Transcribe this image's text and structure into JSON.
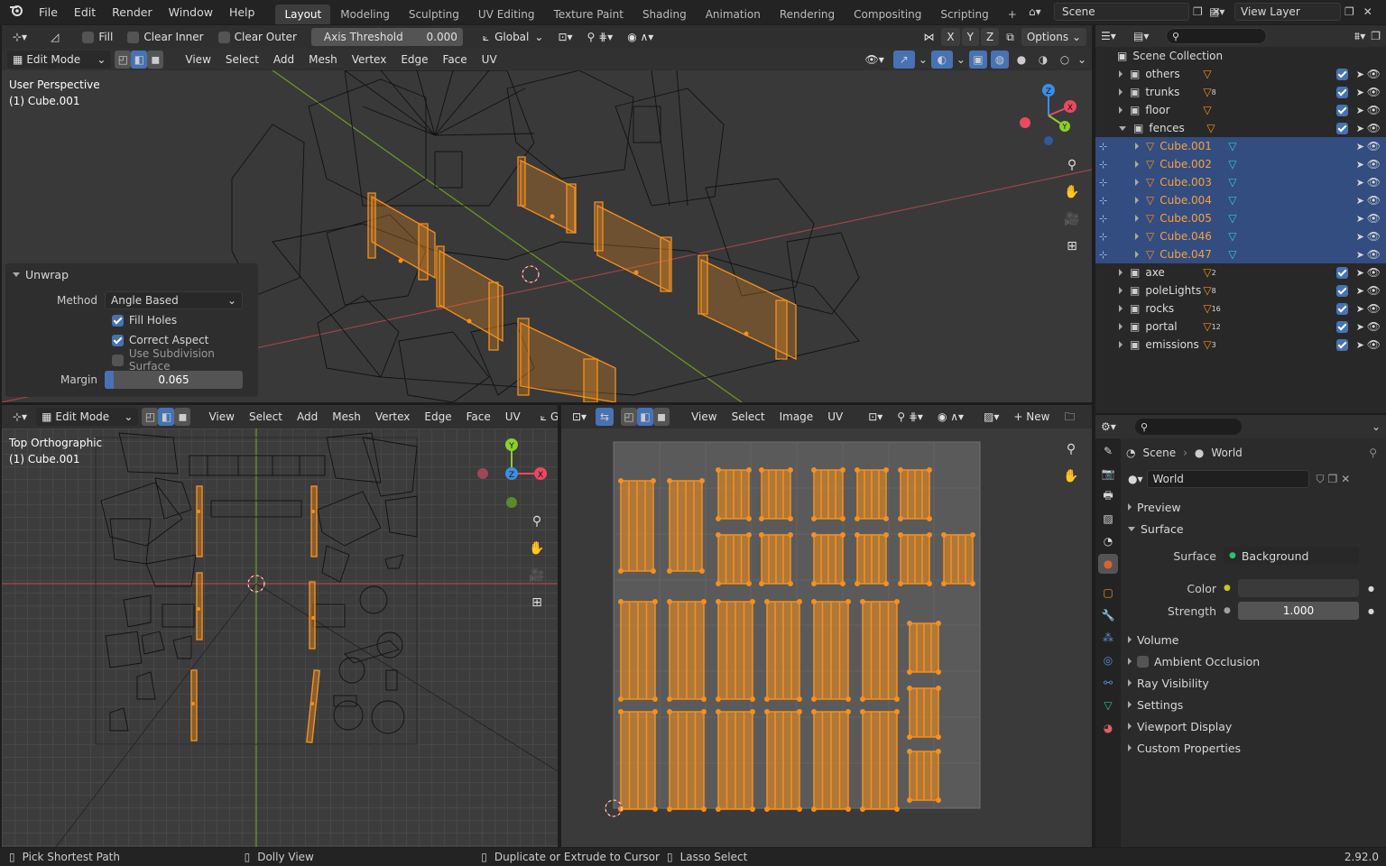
{
  "topbar": {
    "menus": [
      "File",
      "Edit",
      "Render",
      "Window",
      "Help"
    ],
    "tabs": [
      "Layout",
      "Modeling",
      "Sculpting",
      "UV Editing",
      "Texture Paint",
      "Shading",
      "Animation",
      "Rendering",
      "Compositing",
      "Scripting"
    ],
    "active_tab": "Layout",
    "scene": "Scene",
    "view_layer": "View Layer"
  },
  "viewport_top": {
    "tool_header": {
      "fill": "Fill",
      "clear_inner": "Clear Inner",
      "clear_outer": "Clear Outer",
      "axis_threshold_label": "Axis Threshold",
      "axis_threshold_value": "0.000",
      "orientation": "Global",
      "axes": [
        "X",
        "Y",
        "Z"
      ],
      "options": "Options"
    },
    "header": {
      "mode": "Edit Mode",
      "menus": [
        "View",
        "Select",
        "Add",
        "Mesh",
        "Vertex",
        "Edge",
        "Face",
        "UV"
      ]
    },
    "overlay_title": "User Perspective",
    "overlay_object": "(1) Cube.001",
    "gizmo_axes": [
      "Z",
      "X",
      "Y"
    ]
  },
  "unwrap_panel": {
    "title": "Unwrap",
    "method_label": "Method",
    "method_value": "Angle Based",
    "fill_holes": "Fill Holes",
    "correct_aspect": "Correct Aspect",
    "use_subdivision": "Use Subdivision Surface",
    "margin_label": "Margin",
    "margin_value": "0.065",
    "margin_fraction": 0.065
  },
  "viewport_bottom": {
    "header": {
      "mode": "Edit Mode",
      "menus": [
        "View",
        "Select",
        "Add",
        "Mesh",
        "Vertex",
        "Edge",
        "Face",
        "UV"
      ],
      "orientation": "Glob"
    },
    "overlay_title": "Top Orthographic",
    "overlay_object": "(1) Cube.001",
    "gizmo_axes": [
      "Y",
      "Z",
      "X"
    ]
  },
  "uv_editor": {
    "menus": [
      "View",
      "Select",
      "Image",
      "UV"
    ],
    "new_label": "New"
  },
  "outliner": {
    "root": "Scene Collection",
    "items": [
      {
        "name": "others",
        "count": "",
        "selected": false,
        "expanded": false,
        "child": false
      },
      {
        "name": "trunks",
        "count": "8",
        "selected": false,
        "expanded": false,
        "child": false
      },
      {
        "name": "floor",
        "count": "",
        "selected": false,
        "expanded": false,
        "child": false
      },
      {
        "name": "fences",
        "count": "",
        "selected": false,
        "expanded": true,
        "child": false
      },
      {
        "name": "Cube.001",
        "count": "",
        "selected": true,
        "expanded": false,
        "child": true
      },
      {
        "name": "Cube.002",
        "count": "",
        "selected": true,
        "expanded": false,
        "child": true
      },
      {
        "name": "Cube.003",
        "count": "",
        "selected": true,
        "expanded": false,
        "child": true
      },
      {
        "name": "Cube.004",
        "count": "",
        "selected": true,
        "expanded": false,
        "child": true
      },
      {
        "name": "Cube.005",
        "count": "",
        "selected": true,
        "expanded": false,
        "child": true
      },
      {
        "name": "Cube.046",
        "count": "",
        "selected": true,
        "expanded": false,
        "child": true
      },
      {
        "name": "Cube.047",
        "count": "",
        "selected": true,
        "expanded": false,
        "child": true
      },
      {
        "name": "axe",
        "count": "2",
        "selected": false,
        "expanded": false,
        "child": false
      },
      {
        "name": "poleLights",
        "count": "8",
        "selected": false,
        "expanded": false,
        "child": false
      },
      {
        "name": "rocks",
        "count": "16",
        "selected": false,
        "expanded": false,
        "child": false
      },
      {
        "name": "portal",
        "count": "12",
        "selected": false,
        "expanded": false,
        "child": false
      },
      {
        "name": "emissions",
        "count": "3",
        "selected": false,
        "expanded": false,
        "child": false
      }
    ]
  },
  "properties": {
    "breadcrumb_scene": "Scene",
    "breadcrumb_world": "World",
    "world_name": "World",
    "sections_top": [
      "Preview",
      "Surface"
    ],
    "surface_label": "Surface",
    "surface_value": "Background",
    "color_label": "Color",
    "strength_label": "Strength",
    "strength_value": "1.000",
    "sections_bottom": [
      "Volume",
      "Ambient Occlusion",
      "Ray Visibility",
      "Settings",
      "Viewport Display",
      "Custom Properties"
    ]
  },
  "statusbar": {
    "item1": "Pick Shortest Path",
    "item2": "Dolly View",
    "item3": "Duplicate or Extrude to Cursor",
    "item4": "Lasso Select",
    "version": "2.92.0"
  },
  "colors": {
    "accent": "#4772b3",
    "selection_orange": "#f5901e",
    "outliner_selected": "#334d80",
    "axis_x": "#e84a5f",
    "axis_y": "#8bcf2a",
    "axis_z": "#3b8fe6"
  }
}
